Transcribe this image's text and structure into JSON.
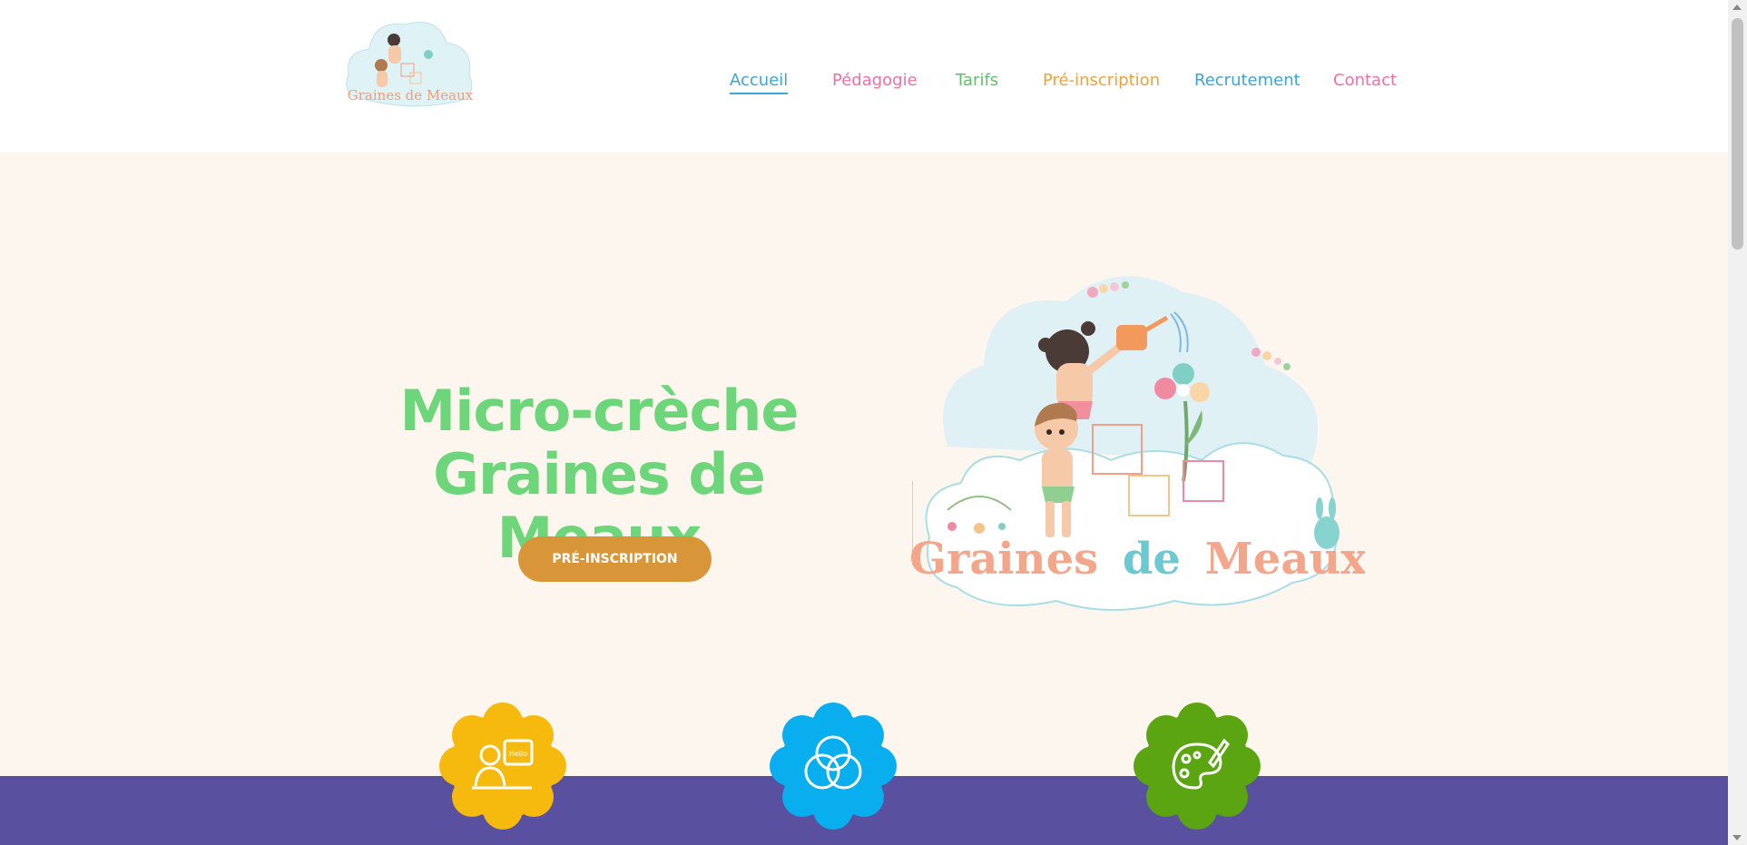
{
  "logo": {
    "text": "Graines de Meaux"
  },
  "nav": {
    "items": [
      {
        "label": "Accueil",
        "color": "#3aa6d6",
        "active": true
      },
      {
        "label": "Pédagogie",
        "color": "#ef6fa6"
      },
      {
        "label": "Tarifs",
        "color": "#5fc06a"
      },
      {
        "label": "Pré-inscription",
        "color": "#f0a238"
      },
      {
        "label": "Recrutement",
        "color": "#3aa6d6"
      },
      {
        "label": "Contact",
        "color": "#ef6fa6"
      }
    ]
  },
  "hero": {
    "title_line1": "Micro-crèche",
    "title_line2": "Graines de Meaux",
    "cta_label": "PRÉ-INSCRIPTION",
    "illustration_text_1": "Graines",
    "illustration_text_2": "de",
    "illustration_text_3": "Meaux"
  },
  "features": [
    {
      "icon": "teacher-board-icon",
      "color": "#f6b90d",
      "icon_text": "Hello"
    },
    {
      "icon": "venn-circles-icon",
      "color": "#08aeee"
    },
    {
      "icon": "paint-palette-icon",
      "color": "#5aa511"
    }
  ],
  "colors": {
    "hero_bg": "#fdf6ef",
    "title": "#6ed67a",
    "cta": "#d99638",
    "band": "#5a50a0"
  }
}
